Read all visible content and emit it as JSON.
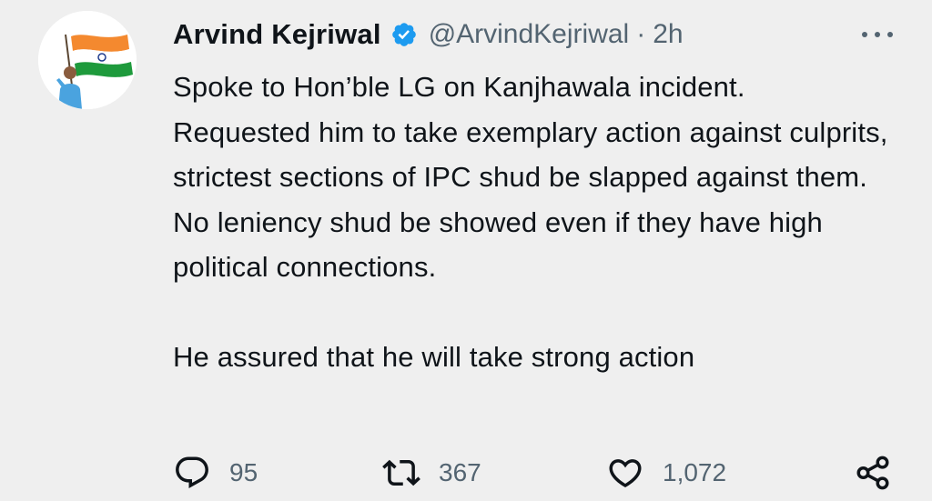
{
  "author": {
    "display_name": "Arvind Kejriwal",
    "handle": "@ArvindKejriwal",
    "separator": "·",
    "time": "2h",
    "verified": true
  },
  "tweet": {
    "text": "Spoke to Hon’ble LG on Kanjhawala incident.\nRequested him to take exemplary action against culprits, strictest sections of IPC shud be slapped against them. No leniency shud be showed even if they have high political connections.\n\nHe assured that he will take strong action"
  },
  "actions": {
    "reply_count": "95",
    "retweet_count": "367",
    "like_count": "1,072"
  },
  "icons": {
    "verified": "verified-badge-icon",
    "more": "more-options-icon",
    "reply": "reply-icon",
    "retweet": "retweet-icon",
    "like": "heart-icon",
    "share": "share-icon"
  },
  "colors": {
    "background": "#efefef",
    "text": "#0f1419",
    "secondary": "#536471",
    "verified": "#1d9bf0"
  }
}
